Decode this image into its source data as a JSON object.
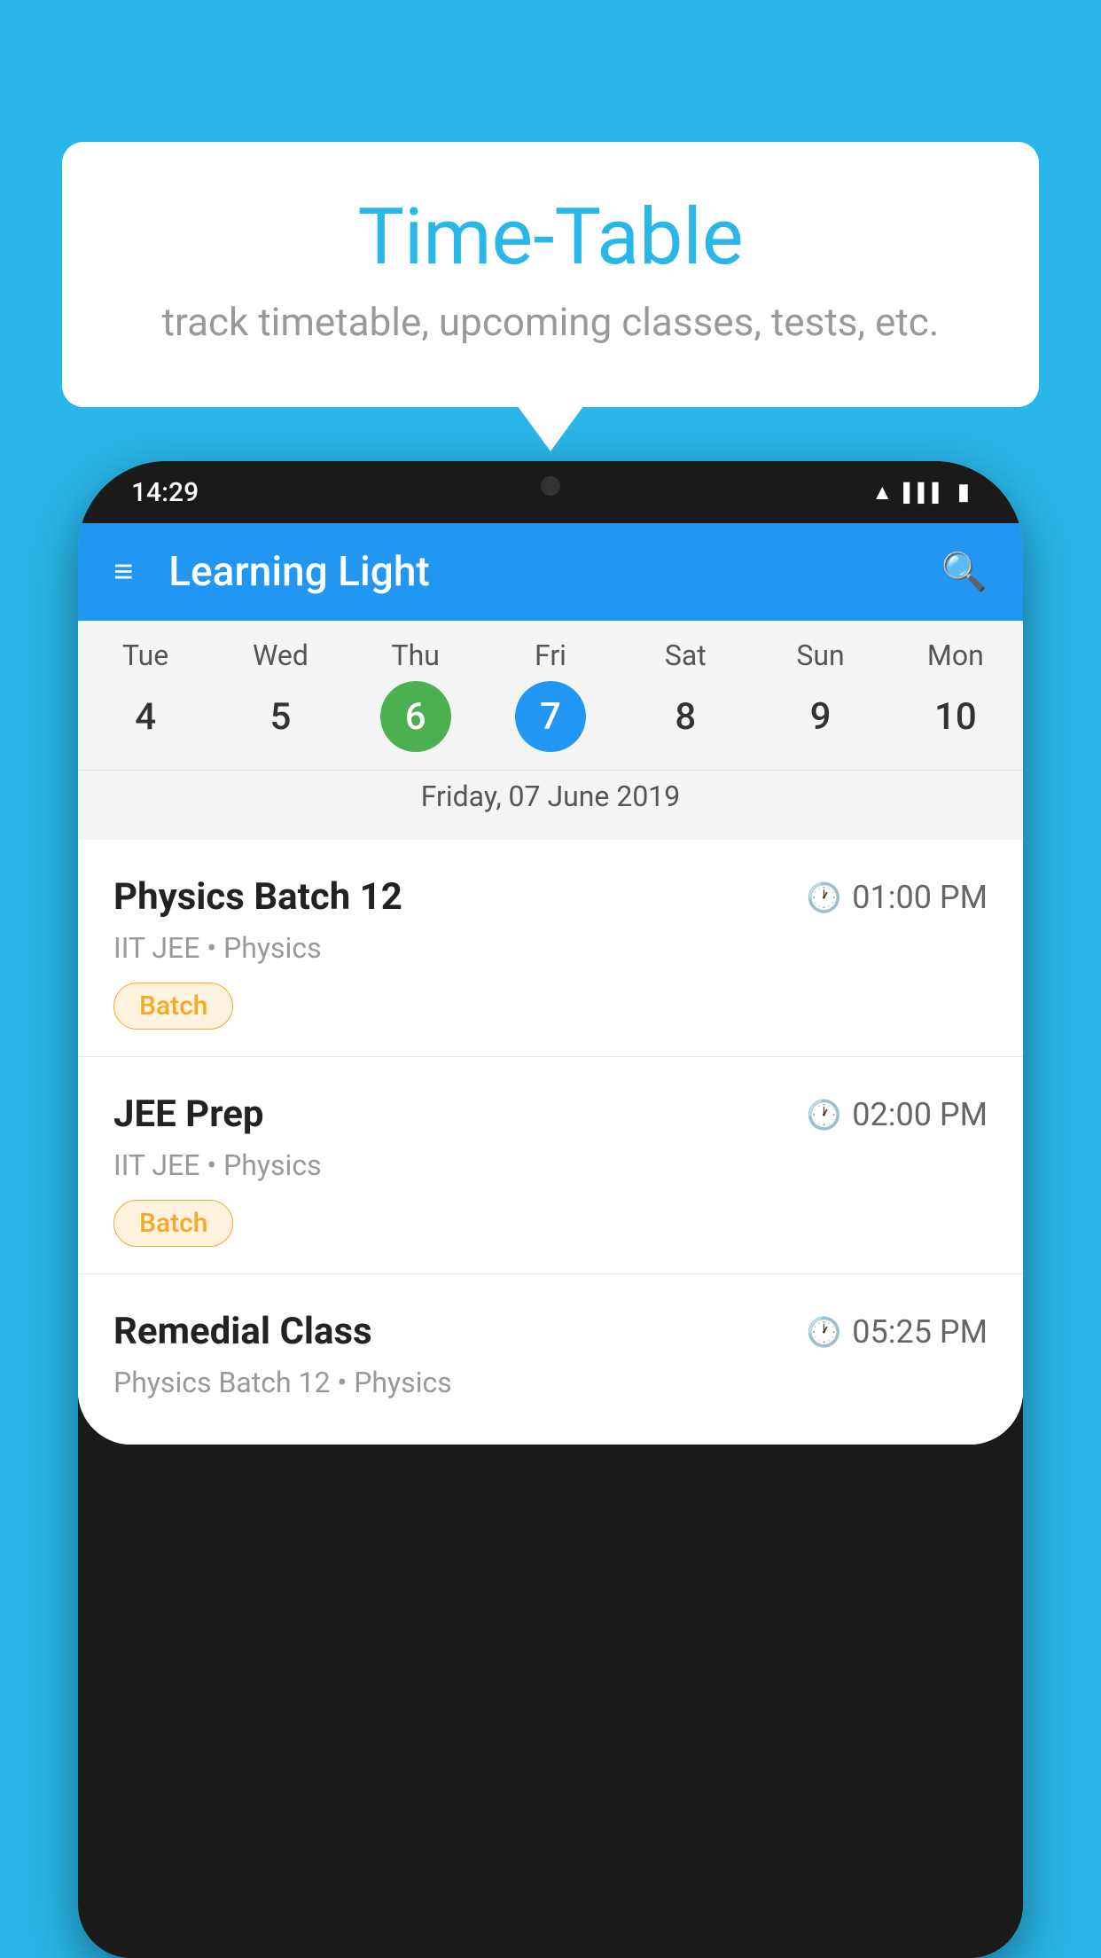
{
  "page": {
    "background_color": "#29B6E8"
  },
  "speech_bubble": {
    "title": "Time-Table",
    "subtitle": "track timetable, upcoming classes, tests, etc."
  },
  "phone": {
    "status_bar": {
      "time": "14:29"
    },
    "app_bar": {
      "title": "Learning Light"
    },
    "calendar": {
      "days": [
        {
          "short": "Tue",
          "num": "4"
        },
        {
          "short": "Wed",
          "num": "5"
        },
        {
          "short": "Thu",
          "num": "6",
          "state": "today"
        },
        {
          "short": "Fri",
          "num": "7",
          "state": "selected"
        },
        {
          "short": "Sat",
          "num": "8"
        },
        {
          "short": "Sun",
          "num": "9"
        },
        {
          "short": "Mon",
          "num": "10"
        }
      ],
      "selected_date": "Friday, 07 June 2019"
    },
    "schedule": [
      {
        "title": "Physics Batch 12",
        "time": "01:00 PM",
        "meta": "IIT JEE • Physics",
        "tag": "Batch"
      },
      {
        "title": "JEE Prep",
        "time": "02:00 PM",
        "meta": "IIT JEE • Physics",
        "tag": "Batch"
      },
      {
        "title": "Remedial Class",
        "time": "05:25 PM",
        "meta": "Physics Batch 12 • Physics",
        "tag": ""
      }
    ]
  },
  "icons": {
    "hamburger": "≡",
    "search": "🔍",
    "clock": "🕐"
  }
}
